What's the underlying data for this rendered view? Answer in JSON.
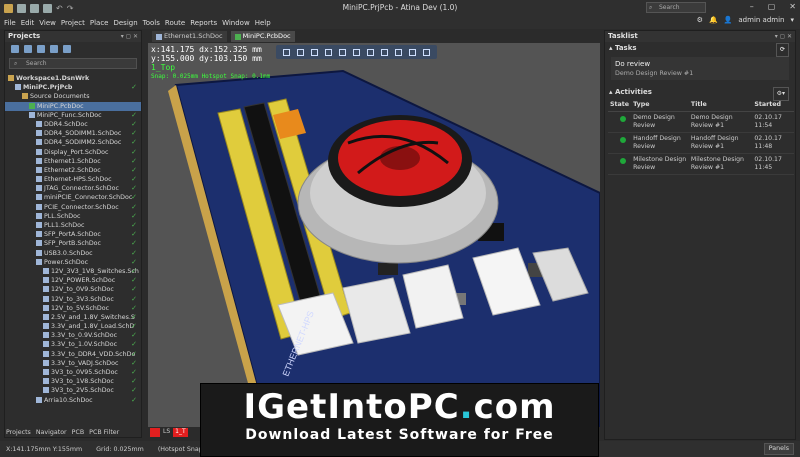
{
  "title": "MiniPC.PrjPcb - Atina Dev (1.0)",
  "search_placeholder": "Search",
  "menu": [
    "File",
    "Edit",
    "View",
    "Project",
    "Place",
    "Design",
    "Tools",
    "Route",
    "Reports",
    "Window",
    "Help"
  ],
  "user": "admin admin",
  "projects_panel": {
    "title": "Projects",
    "search_placeholder": "Search",
    "tree": [
      {
        "label": "Workspace1.DsnWrk",
        "type": "folder",
        "indent": 0,
        "check": false,
        "bold": true
      },
      {
        "label": "MiniPC.PrjPcb",
        "type": "doc",
        "indent": 1,
        "check": true,
        "bold": true
      },
      {
        "label": "Source Documents",
        "type": "folder",
        "indent": 2,
        "check": false
      },
      {
        "label": "MiniPC.PcbDoc",
        "type": "pcb",
        "indent": 3,
        "check": false,
        "selected": true
      },
      {
        "label": "MiniPC_Func.SchDoc",
        "type": "doc",
        "indent": 3,
        "check": true
      },
      {
        "label": "DDR4.SchDoc",
        "type": "doc",
        "indent": 4,
        "check": true
      },
      {
        "label": "DDR4_SODIMM1.SchDoc",
        "type": "doc",
        "indent": 4,
        "check": true
      },
      {
        "label": "DDR4_SODIMM2.SchDoc",
        "type": "doc",
        "indent": 4,
        "check": true
      },
      {
        "label": "Display_Port.SchDoc",
        "type": "doc",
        "indent": 4,
        "check": true
      },
      {
        "label": "Ethernet1.SchDoc",
        "type": "doc",
        "indent": 4,
        "check": true
      },
      {
        "label": "Ethernet2.SchDoc",
        "type": "doc",
        "indent": 4,
        "check": true
      },
      {
        "label": "Ethernet-HPS.SchDoc",
        "type": "doc",
        "indent": 4,
        "check": true
      },
      {
        "label": "JTAG_Connector.SchDoc",
        "type": "doc",
        "indent": 4,
        "check": true
      },
      {
        "label": "miniPCIE_Connector.SchDoc",
        "type": "doc",
        "indent": 4,
        "check": true
      },
      {
        "label": "PCIE_Connector.SchDoc",
        "type": "doc",
        "indent": 4,
        "check": true
      },
      {
        "label": "PLL.SchDoc",
        "type": "doc",
        "indent": 4,
        "check": true
      },
      {
        "label": "PLL1.SchDoc",
        "type": "doc",
        "indent": 4,
        "check": true
      },
      {
        "label": "SFP_PortA.SchDoc",
        "type": "doc",
        "indent": 4,
        "check": true
      },
      {
        "label": "SFP_PortB.SchDoc",
        "type": "doc",
        "indent": 4,
        "check": true
      },
      {
        "label": "USB3.0.SchDoc",
        "type": "doc",
        "indent": 4,
        "check": true
      },
      {
        "label": "Power.SchDoc",
        "type": "doc",
        "indent": 4,
        "check": true
      },
      {
        "label": "12V_3V3_1V8_Switches.Sch",
        "type": "doc",
        "indent": 5,
        "check": true
      },
      {
        "label": "12V_POWER.SchDoc",
        "type": "doc",
        "indent": 5,
        "check": true
      },
      {
        "label": "12V_to_0V9.SchDoc",
        "type": "doc",
        "indent": 5,
        "check": true
      },
      {
        "label": "12V_to_3V3.SchDoc",
        "type": "doc",
        "indent": 5,
        "check": true
      },
      {
        "label": "12V_to_5V.SchDoc",
        "type": "doc",
        "indent": 5,
        "check": true
      },
      {
        "label": "2.5V_and_1.8V_Switches.S",
        "type": "doc",
        "indent": 5,
        "check": true
      },
      {
        "label": "3.3V_and_1.8V_Load.SchD",
        "type": "doc",
        "indent": 5,
        "check": true
      },
      {
        "label": "3.3V_to_0.9V.SchDoc",
        "type": "doc",
        "indent": 5,
        "check": true
      },
      {
        "label": "3.3V_to_1.0V.SchDoc",
        "type": "doc",
        "indent": 5,
        "check": true
      },
      {
        "label": "3.3V_to_DDR4_VDD.SchDo",
        "type": "doc",
        "indent": 5,
        "check": true
      },
      {
        "label": "3.3V_to_VADJ.SchDoc",
        "type": "doc",
        "indent": 5,
        "check": true
      },
      {
        "label": "3V3_to_0V95.SchDoc",
        "type": "doc",
        "indent": 5,
        "check": true
      },
      {
        "label": "3V3_to_1V8.SchDoc",
        "type": "doc",
        "indent": 5,
        "check": true
      },
      {
        "label": "3V3_to_2V5.SchDoc",
        "type": "doc",
        "indent": 5,
        "check": true
      },
      {
        "label": "Arria10.SchDoc",
        "type": "doc",
        "indent": 4,
        "check": true
      }
    ]
  },
  "bottom_tabs": [
    "Projects",
    "Navigator",
    "PCB",
    "PCB Filter"
  ],
  "status": [
    "X:141.175mm Y:155mm",
    "Grid: 0.025mm",
    "(Hotspot Snap)"
  ],
  "panels_button": "Panels",
  "doc_tabs": [
    {
      "label": "Ethernet1.SchDoc",
      "active": false
    },
    {
      "label": "MiniPC.PcbDoc",
      "active": true
    }
  ],
  "coords": {
    "line1": "x:141.175  dx:152.325 mm",
    "line2": "y:155.000  dy:103.150 mm",
    "layer": "1_Top",
    "snap": "Snap: 0.025mm Hotspot Snap: 0.1mm"
  },
  "board_labels": [
    "ETHERNET-HPS"
  ],
  "layer_tags": [
    "LS",
    "1_T"
  ],
  "tasklist": {
    "title": "Tasklist",
    "tasks_label": "Tasks",
    "task": {
      "title": "Do review",
      "subtitle": "Demo Design Review #1"
    },
    "activities_label": "Activities",
    "columns": [
      "State",
      "Type",
      "Title",
      "Started"
    ],
    "rows": [
      {
        "type": "Demo Design Review",
        "title": "Demo Design Review #1",
        "started": "02.10.17 11:54"
      },
      {
        "type": "Handoff Design Review",
        "title": "Handoff Design Review #1",
        "started": "02.10.17 11:48"
      },
      {
        "type": "Milestone Design Review",
        "title": "Milestone Design Review #1",
        "started": "02.10.17 11:45"
      }
    ]
  },
  "banner": {
    "main_a": "IGetIntoPC",
    "main_dot": ".",
    "main_b": "com",
    "sub": "Download Latest Software for Free"
  },
  "colors": {
    "accent": "#29c6d8",
    "pcb_board": "#1c2f6e",
    "gold": "#d9c64a",
    "fan_red": "#d21a1a",
    "ok": "#1fa83a"
  }
}
